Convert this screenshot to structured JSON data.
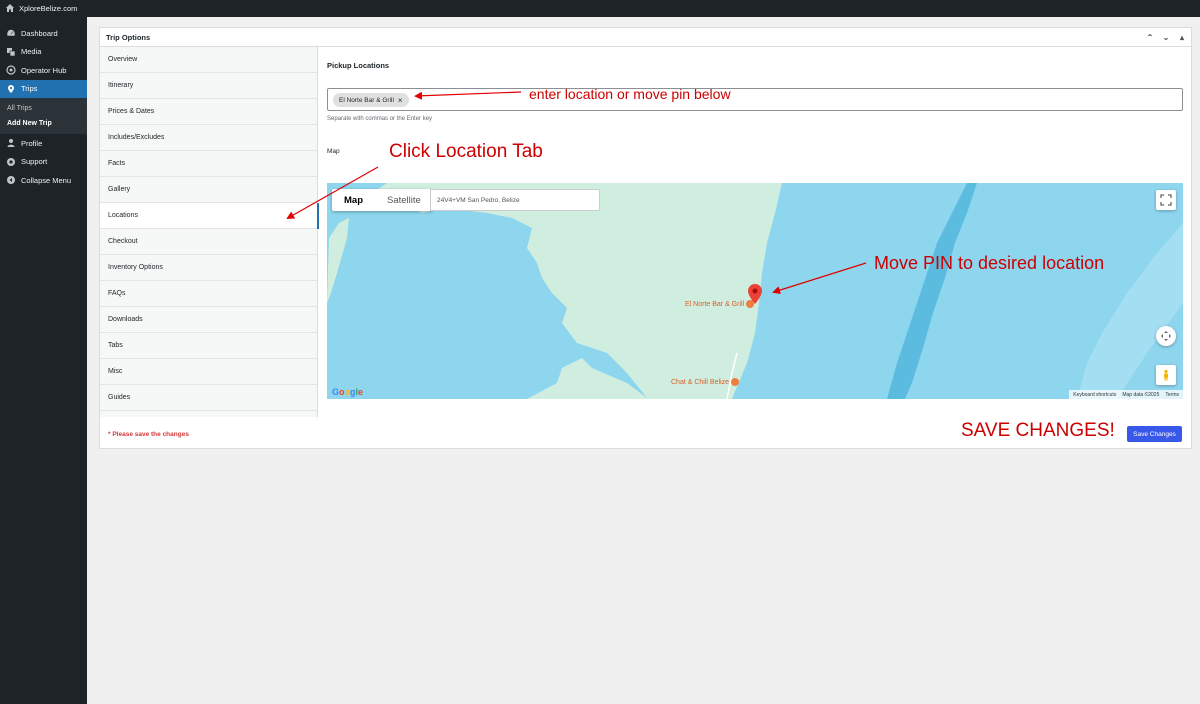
{
  "adminbar": {
    "site_name": "XploreBelize.com",
    "site_icon": "home-icon"
  },
  "sidebar": {
    "items": [
      {
        "label": "Dashboard",
        "icon": "dashboard-icon"
      },
      {
        "label": "Media",
        "icon": "media-icon"
      },
      {
        "label": "Operator Hub",
        "icon": "operator-hub-icon"
      },
      {
        "label": "Trips",
        "icon": "location-pin-icon",
        "active": true
      },
      {
        "label": "Profile",
        "icon": "user-icon"
      },
      {
        "label": "Support",
        "icon": "support-icon"
      },
      {
        "label": "Collapse Menu",
        "icon": "collapse-icon"
      }
    ],
    "submenu": [
      {
        "label": "All Trips"
      },
      {
        "label": "Add New Trip",
        "current": true
      }
    ]
  },
  "postbox": {
    "title": "Trip Options",
    "tabs": [
      "Overview",
      "Itinerary",
      "Prices & Dates",
      "Includes/Excludes",
      "Facts",
      "Gallery",
      "Locations",
      "Checkout",
      "Inventory Options",
      "FAQs",
      "Downloads",
      "Tabs",
      "Misc",
      "Guides"
    ],
    "active_tab": "Locations"
  },
  "locations": {
    "section_title": "Pickup Locations",
    "tag": "El Norte Bar & Grill",
    "tag_remove": "×",
    "hint": "Separate with commas or the Enter key",
    "map_label": "Map"
  },
  "map": {
    "type_map": "Map",
    "type_satellite": "Satellite",
    "search_value": "24V4+VM San Pedro, Belize",
    "places": [
      "El Norte Bar & Grill",
      "Chat & Chill Belize"
    ],
    "google": "Google",
    "footer": [
      "Keyboard shortcuts",
      "Map data ©2025",
      "Terms"
    ],
    "colors": {
      "water": "#8ed6ee",
      "land": "#cfeee0",
      "pin": "#ea4335"
    }
  },
  "footer": {
    "note": "* Please save the changes",
    "save_button": "Save Changes"
  },
  "annotations": {
    "enter_location": "enter location or move pin below",
    "click_tab": "Click Location Tab",
    "move_pin": "Move PIN to desired location",
    "save": "SAVE CHANGES!",
    "color": "#cc0000"
  }
}
